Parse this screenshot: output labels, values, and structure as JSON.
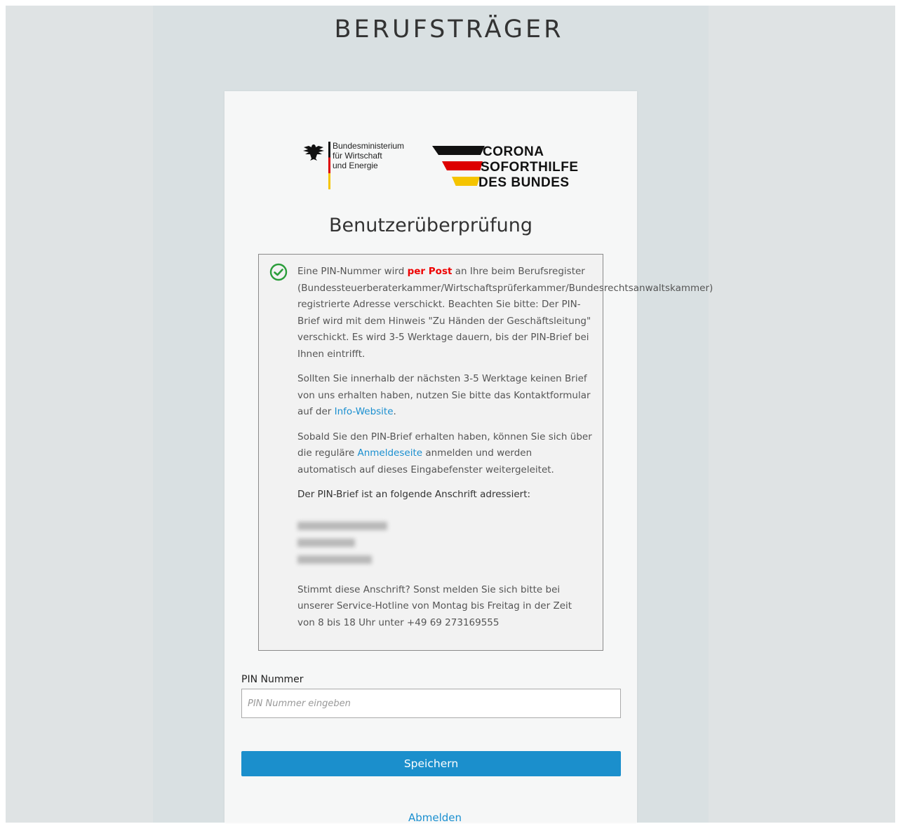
{
  "header": {
    "title": "BERUFSTRÄGER"
  },
  "logos": {
    "ministry_lines": [
      "Bundesministerium",
      "für Wirtschaft",
      "und Energie"
    ],
    "corona_lines": [
      "CORONA",
      "SOFORTHILFE",
      "DES BUNDES"
    ]
  },
  "card": {
    "heading": "Benutzerüberprüfung",
    "info": {
      "p1_a": "Eine PIN-Nummer wird ",
      "p1_highlight": "per Post",
      "p1_b": " an Ihre beim Berufsregister (Bundessteuerberaterkammer/Wirtschaftsprüferkammer/Bundesrechtsanwaltskammer) registrierte Adresse verschickt. Beachten Sie bitte: Der PIN-Brief wird mit dem Hinweis \"Zu Händen der Geschäftsleitung\" verschickt. Es wird 3-5 Werktage dauern, bis der PIN-Brief bei Ihnen eintrifft.",
      "p2_a": "Sollten Sie innerhalb der nächsten 3-5 Werktage keinen Brief von uns erhalten haben, nutzen Sie bitte das Kontaktformular auf der ",
      "p2_link": "Info-Website",
      "p2_b": ".",
      "p3_a": "Sobald Sie den PIN-Brief erhalten haben, können Sie sich über die reguläre ",
      "p3_link": "Anmeldeseite",
      "p3_b": " anmelden und werden automatisch auf dieses Eingabefenster weitergeleitet.",
      "p4": "Der PIN-Brief ist an folgende Anschrift adressiert:",
      "p5": "Stimmt diese Anschrift? Sonst melden Sie sich bitte bei unserer Service-Hotline von Montag bis Freitag in der Zeit von 8 bis 18 Uhr unter +49 69 273169555"
    },
    "pin": {
      "label": "PIN Nummer",
      "placeholder": "PIN Nummer eingeben",
      "value": ""
    },
    "save_label": "Speichern",
    "logout_label": "Abmelden"
  },
  "colors": {
    "accent": "#1b8fcc",
    "link": "#1a8fd0",
    "highlight": "#e00000",
    "check": "#2a9d3a"
  }
}
